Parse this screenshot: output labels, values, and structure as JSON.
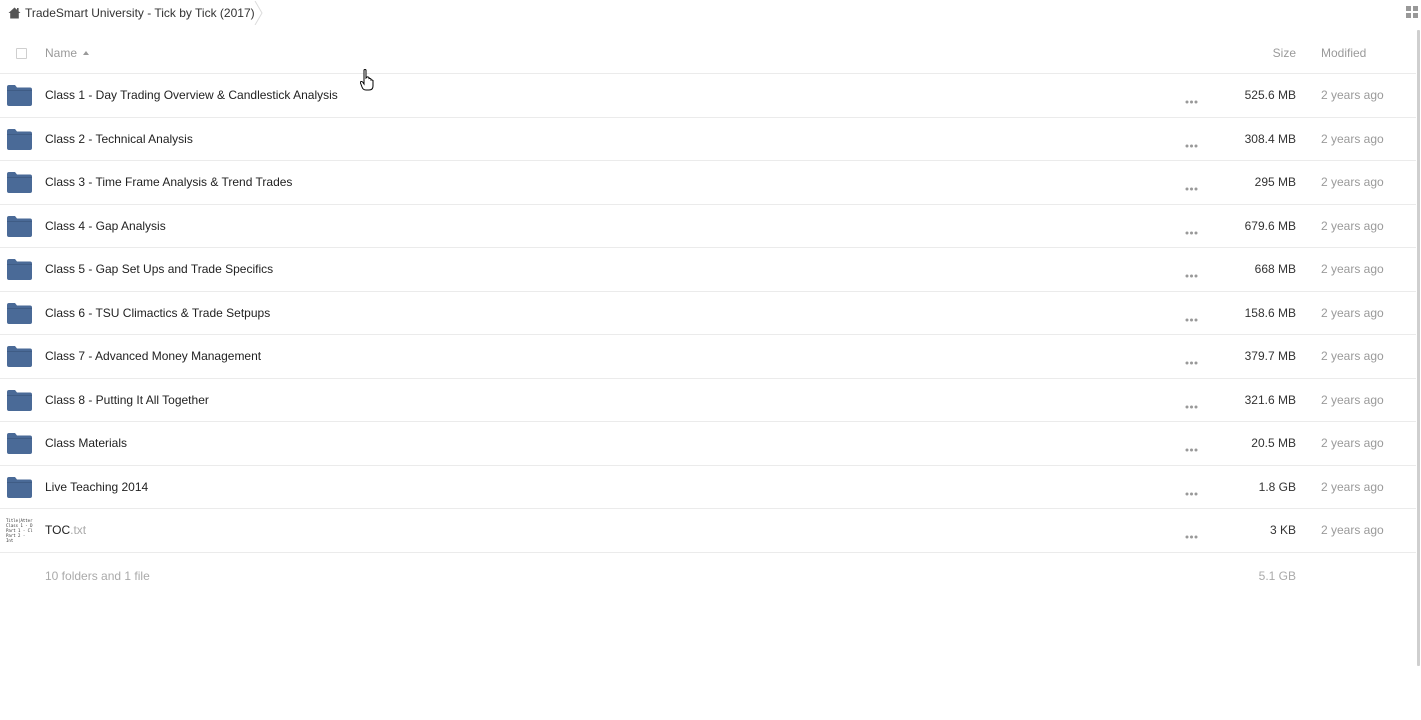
{
  "breadcrumb": {
    "home_icon": "home-icon",
    "label": "TradeSmart University - Tick by Tick (2017)"
  },
  "header": {
    "name": "Name",
    "size": "Size",
    "modified": "Modified",
    "sort": "ascending"
  },
  "rows": [
    {
      "icon": "folder-icon",
      "name": "Class 1 - Day Trading Overview & Candlestick Analysis",
      "ext": "",
      "size": "525.6 MB",
      "modified": "2 years ago"
    },
    {
      "icon": "folder-icon",
      "name": "Class 2 - Technical Analysis",
      "ext": "",
      "size": "308.4 MB",
      "modified": "2 years ago"
    },
    {
      "icon": "folder-icon",
      "name": "Class 3 - Time Frame Analysis & Trend Trades",
      "ext": "",
      "size": "295 MB",
      "modified": "2 years ago"
    },
    {
      "icon": "folder-icon",
      "name": "Class 4 - Gap Analysis",
      "ext": "",
      "size": "679.6 MB",
      "modified": "2 years ago"
    },
    {
      "icon": "folder-icon",
      "name": "Class 5 - Gap Set Ups and Trade Specifics",
      "ext": "",
      "size": "668 MB",
      "modified": "2 years ago"
    },
    {
      "icon": "folder-icon",
      "name": "Class 6 - TSU Climactics & Trade Setpups",
      "ext": "",
      "size": "158.6 MB",
      "modified": "2 years ago"
    },
    {
      "icon": "folder-icon",
      "name": "Class 7 - Advanced Money Management",
      "ext": "",
      "size": "379.7 MB",
      "modified": "2 years ago"
    },
    {
      "icon": "folder-icon",
      "name": "Class 8 - Putting It All Together",
      "ext": "",
      "size": "321.6 MB",
      "modified": "2 years ago"
    },
    {
      "icon": "folder-icon",
      "name": "Class Materials",
      "ext": "",
      "size": "20.5 MB",
      "modified": "2 years ago"
    },
    {
      "icon": "folder-icon",
      "name": "Live Teaching 2014",
      "ext": "",
      "size": "1.8 GB",
      "modified": "2 years ago"
    },
    {
      "icon": "text-file-thumbnail",
      "name": "TOC",
      "ext": ".txt",
      "size": "3 KB",
      "modified": "2 years ago",
      "thumbnail_lines": [
        "Title|Atter",
        "Class 1 - D",
        "Part 1 - Cl",
        "Part 2 - Int"
      ]
    }
  ],
  "summary": {
    "count": "10 folders and 1 file",
    "total_size": "5.1 GB"
  },
  "colors": {
    "folder": "#4a6a97",
    "border": "#ebebeb",
    "muted_text": "#9a9a9a"
  }
}
